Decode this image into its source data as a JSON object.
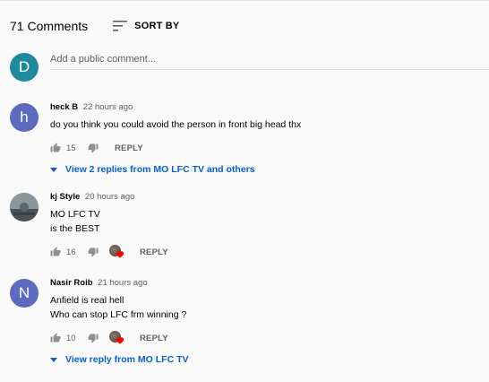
{
  "header": {
    "comment_count": "71 Comments",
    "sort_label": "SORT BY",
    "sort_icon": "sort-icon"
  },
  "add_comment": {
    "avatar_letter": "D",
    "avatar_color": "#1f8a9d",
    "placeholder": "Add a public comment..."
  },
  "comments": [
    {
      "avatar_letter": "h",
      "avatar_color": "#5c6bc0",
      "author": "heck B",
      "time": "22 hours ago",
      "text_lines": [
        "do you think you could avoid the person in front big head thx"
      ],
      "likes": "15",
      "reply_label": "REPLY",
      "creator_hearted": false,
      "view_replies": "View 2 replies from MO LFC TV and others"
    },
    {
      "avatar_letter": "",
      "avatar_color": "#7a868c",
      "author": "kj Style",
      "time": "20 hours ago",
      "text_lines": [
        "MO LFC TV",
        "is the BEST"
      ],
      "likes": "16",
      "reply_label": "REPLY",
      "creator_hearted": true,
      "view_replies": ""
    },
    {
      "avatar_letter": "N",
      "avatar_color": "#5c6bc0",
      "author": "Nasir Roib",
      "time": "21 hours ago",
      "text_lines": [
        "Anfield is real hell",
        "Who can stop LFC frm winning ?"
      ],
      "likes": "10",
      "reply_label": "REPLY",
      "creator_hearted": true,
      "view_replies": "View reply from MO LFC TV"
    }
  ],
  "colors": {
    "link": "#065fd4",
    "heart": "#ff0000",
    "secondary_text": "#606060"
  }
}
